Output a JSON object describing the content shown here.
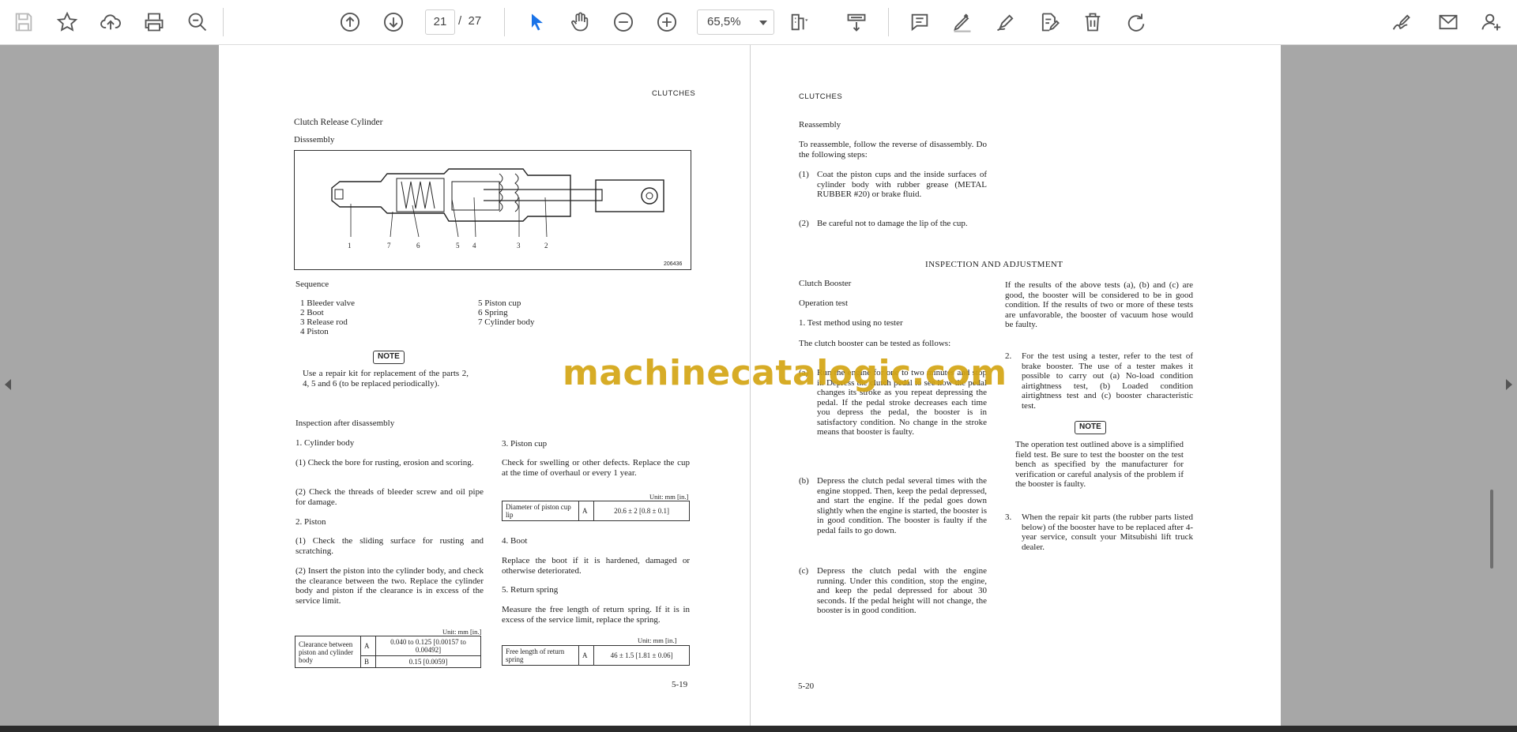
{
  "toolbar": {
    "current_page": "21",
    "page_sep": "/",
    "total_pages": "27",
    "zoom": "65,5%"
  },
  "icons": [
    "save-icon",
    "bookmark-star-icon",
    "upload-cloud-icon",
    "print-icon",
    "zoom-out-search-icon",
    "previous-page-icon",
    "next-page-icon",
    "select-cursor-icon",
    "hand-pan-icon",
    "zoom-out-icon",
    "zoom-in-icon",
    "fit-page-icon",
    "scroll-mode-icon",
    "comment-icon",
    "highlight-pen-icon",
    "draw-icon",
    "edit-document-icon",
    "delete-icon",
    "redo-icon",
    "sign-icon",
    "email-icon",
    "add-user-icon"
  ],
  "watermark": "machinecatalogic.com",
  "left_page": {
    "header": "CLUTCHES",
    "title": "Clutch Release Cylinder",
    "disassembly": "Disssembly",
    "figure_code": "206436",
    "callouts": [
      "1",
      "7",
      "6",
      "5",
      "4",
      "3",
      "2"
    ],
    "sequence_title": "Sequence",
    "sequence": [
      "1 Bleeder valve",
      "2 Boot",
      "3 Release rod",
      "4 Piston",
      "5 Piston cup",
      "6 Spring",
      "7 Cylinder body"
    ],
    "note_label": "NOTE",
    "note_text": "Use a repair kit for replacement of the parts 2, 4, 5 and 6 (to be replaced periodically).",
    "inspection_title": "Inspection after disassembly",
    "cyl_title": "1.  Cylinder body",
    "cyl_1": "(1)  Check the bore for rusting, erosion and scoring.",
    "cyl_2": "(2)  Check the threads of bleeder screw and oil pipe for damage.",
    "piston_title": "2.  Piston",
    "piston_1": "(1)  Check the sliding surface for rusting and scratching.",
    "piston_2": "(2)  Insert the piston into the cylinder body, and check the clearance between the two. Replace the cylinder body and piston if the clearance is in excess of the service limit.",
    "unit": "Unit: mm [in.]",
    "clear_label": "Clearance between piston and cylinder body",
    "clear_A": "A",
    "clear_A_val": "0.040 to 0.125 [0.00157 to 0.00492]",
    "clear_B": "B",
    "clear_B_val": "0.15 [0.0059]",
    "cup_title": "3.  Piston cup",
    "cup_text": "Check for swelling or other defects. Replace the cup at the time of overhaul or every 1 year.",
    "cup_label": "Diameter of piston cup lip",
    "cup_A": "A",
    "cup_val": "20.6 ± 2 [0.8 ± 0.1]",
    "boot_title": "4.  Boot",
    "boot_text": "Replace the boot if it is hardened, damaged or otherwise deteriorated.",
    "spring_title": "5.  Return spring",
    "spring_text": "Measure the free length of return spring. If it is in excess of the service limit, replace the spring.",
    "spring_label": "Free length of return spring",
    "spring_A": "A",
    "spring_val": "46 ± 1.5 [1.81 ± 0.06]",
    "page_no": "5-19"
  },
  "right_page": {
    "header": "CLUTCHES",
    "reassembly_title": "Reassembly",
    "reassembly_text": "To reassemble, follow the reverse of disassembly. Do the following steps:",
    "re_1": "Coat the piston cups and the inside surfaces of cylinder body with rubber grease (METAL RUBBER #20) or brake fluid.",
    "re_2": "Be careful not to damage the lip of the cup.",
    "section_title": "INSPECTION AND ADJUSTMENT",
    "booster_title": "Clutch Booster",
    "op_title": "Operation test",
    "test_method": "1.  Test method using no tester",
    "test_intro": "The clutch booster can be tested as follows:",
    "a_text": "Run the engine for one to two minutes and stop it. Depress the clutch pedal to see how the pedal changes its stroke as you repeat depressing the pedal. If the pedal stroke decreases each time you depress the pedal, the booster is in satisfactory condition. No change in the stroke means that booster is faulty.",
    "b_text": "Depress the clutch pedal several times with the engine stopped. Then, keep the pedal depressed, and start the engine. If the pedal goes down slightly when the engine is started, the booster is in good condition. The booster is faulty if the pedal fails to go down.",
    "c_text": "Depress the clutch pedal with the engine running. Under this condition, stop the engine, and keep the pedal depressed for about 30 seconds. If the pedal height will not change, the booster is in good condition.",
    "result_text": "If the results of the above tests (a), (b) and (c) are good, the booster will be considered to be in good condition. If the results of two or more of these tests are unfavorable, the booster of vacuum hose would be faulty.",
    "tester_text": "For the test using a tester, refer to the test of brake booster. The use of a tester makes it possible to carry out (a) No-load condition airtightness test, (b) Loaded condition airtightness test and (c) booster characteristic test.",
    "note_label": "NOTE",
    "note_text": "The operation test outlined above is a simplified field test. Be sure to test the booster on the test bench as specified by the manufacturer for verification or careful analysis of the problem if the booster is faulty.",
    "kit_text": "When the repair kit parts (the rubber parts listed below) of the booster have to be replaced after 4-year service, consult your Mitsubishi lift truck dealer.",
    "page_no": "5-20"
  }
}
